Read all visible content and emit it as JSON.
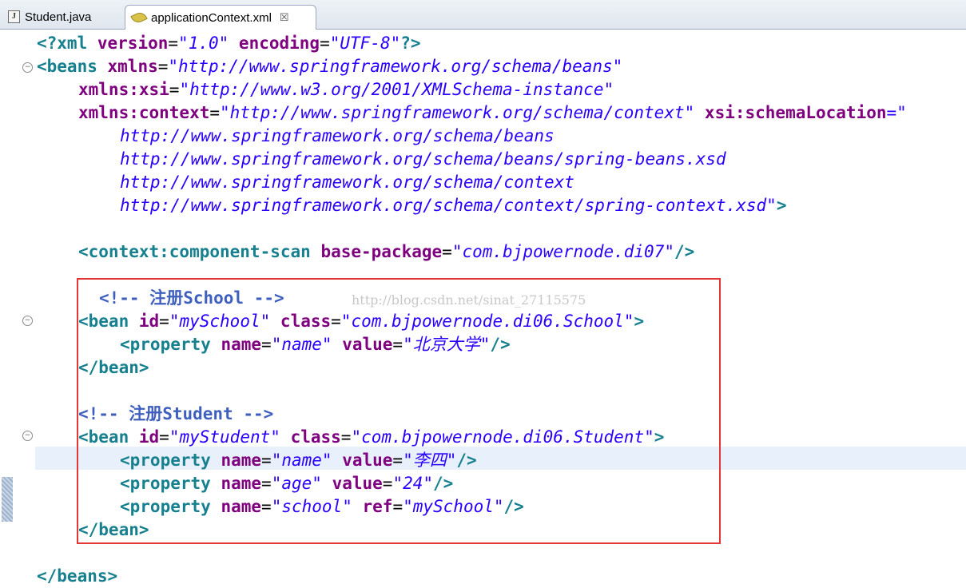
{
  "tabs": [
    {
      "label": "Student.java",
      "icon": "java-file-icon",
      "active": false
    },
    {
      "label": "applicationContext.xml",
      "icon": "xml-leaf-icon",
      "active": true,
      "close": "☒"
    }
  ],
  "code": {
    "l1": {
      "a": "<?xml",
      "b": "version",
      "c": "=",
      "d": "\"1.0\"",
      "e": "encoding",
      "f": "=",
      "g": "\"UTF-8\"",
      "h": "?>"
    },
    "l2": {
      "a": "<beans",
      "b": "xmlns",
      "c": "=",
      "d": "\"http://www.springframework.org/schema/beans\""
    },
    "l3": {
      "a": "xmlns:xsi",
      "b": "=",
      "c": "\"http://www.w3.org/2001/XMLSchema-instance\""
    },
    "l4": {
      "a": "xmlns:context",
      "b": "=",
      "c": "\"http://www.springframework.org/schema/context\"",
      "d": "xsi:schemaLocation",
      "e": "=\""
    },
    "l5": "http://www.springframework.org/schema/beans",
    "l6": "http://www.springframework.org/schema/beans/spring-beans.xsd",
    "l7": "http://www.springframework.org/schema/context",
    "l8": {
      "a": "http://www.springframework.org/schema/context/spring-context.xsd\"",
      "b": ">"
    },
    "l10": {
      "a": "<context:component-scan",
      "b": "base-package",
      "c": "=",
      "d": "\"com.bjpowernode.di07\"",
      "e": "/>"
    },
    "l12": "<!-- 注册School -->",
    "l13": {
      "a": "<bean",
      "b": "id",
      "c": "=",
      "d": "\"mySchool\"",
      "e": "class",
      "f": "=",
      "g": "\"com.bjpowernode.di06.School\"",
      "h": ">"
    },
    "l14": {
      "a": "<property",
      "b": "name",
      "c": "=",
      "d": "\"name\"",
      "e": "value",
      "f": "=",
      "g": "\"北京大学\"",
      "h": "/>"
    },
    "l15": "</bean>",
    "l17": "<!-- 注册Student -->",
    "l18": {
      "a": "<bean",
      "b": "id",
      "c": "=",
      "d": "\"myStudent\"",
      "e": "class",
      "f": "=",
      "g": "\"com.bjpowernode.di06.Student\"",
      "h": ">"
    },
    "l19": {
      "a": "<property",
      "b": "name",
      "c": "=",
      "d": "\"name\"",
      "e": "value",
      "f": "=",
      "g": "\"李四\"",
      "h": "/>"
    },
    "l20": {
      "a": "<property",
      "b": "name",
      "c": "=",
      "d": "\"age\"",
      "e": "value",
      "f": "=",
      "g": "\"24\"",
      "h": "/>"
    },
    "l21": {
      "a": "<property",
      "b": "name",
      "c": "=",
      "d": "\"school\"",
      "e": "ref",
      "f": "=",
      "g": "\"mySchool\"",
      "h": "/>"
    },
    "l22": "</bean>",
    "l24": "</beans>"
  },
  "watermark": "http://blog.csdn.net/sinat_27115575",
  "colors": {
    "tag": "#17808f",
    "attribute": "#7f007f",
    "value": "#2a00ff",
    "comment": "#3f5fbf",
    "highlight_box": "#e53636",
    "current_line": "#e8f0fb"
  }
}
